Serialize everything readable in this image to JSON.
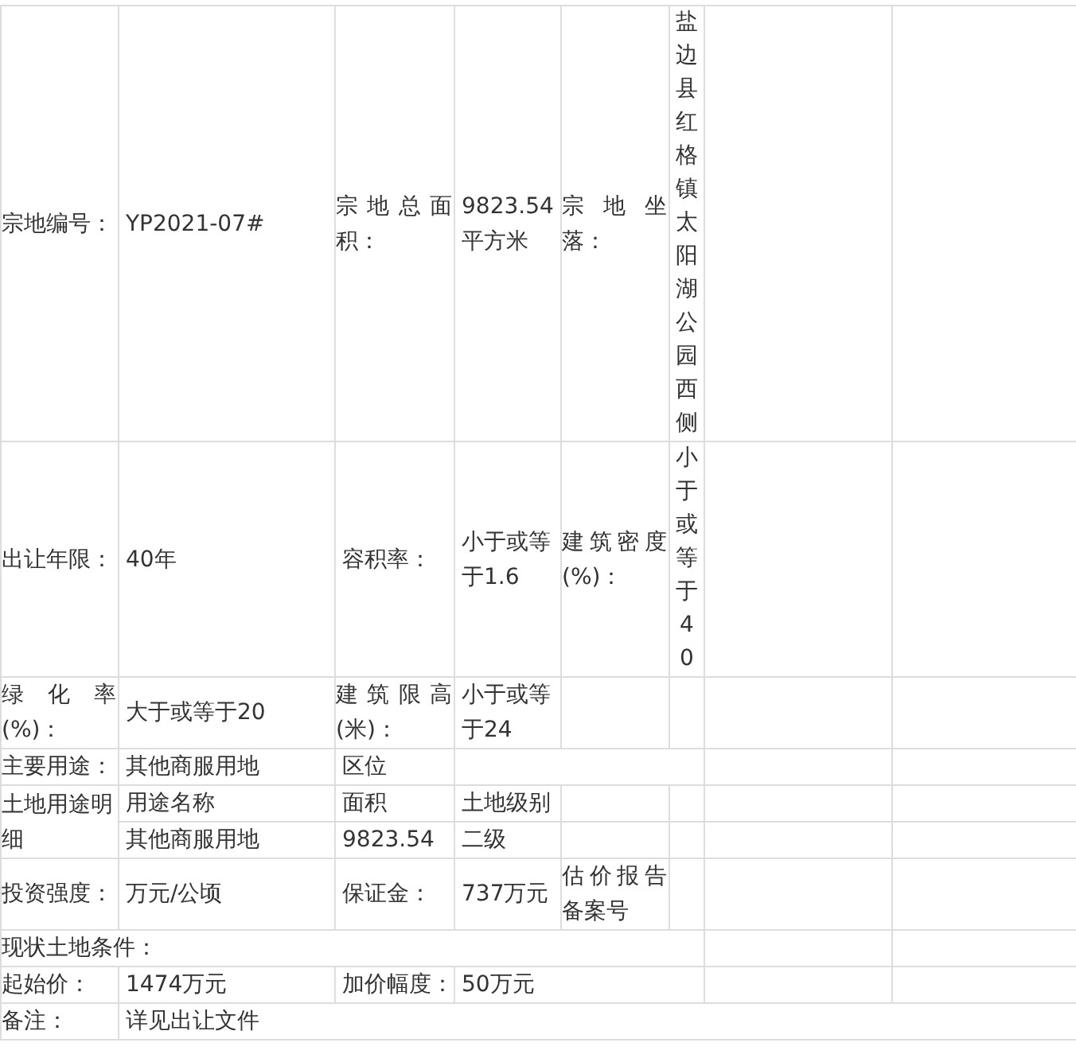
{
  "table": {
    "rows": [
      {
        "cells": [
          {
            "kind": "plain",
            "text": "宗地编号："
          },
          {
            "kind": "plain",
            "text": "YP2021-07#"
          },
          {
            "kind": "justify",
            "text": "宗地总面积："
          },
          {
            "kind": "plain",
            "text": "9823.54平方米"
          },
          {
            "kind": "justify",
            "text": "宗地坐落："
          },
          {
            "kind": "vertical",
            "text": "盐边县红格镇太阳湖公园西侧"
          },
          {
            "kind": "empty"
          },
          {
            "kind": "empty"
          }
        ]
      },
      {
        "cells": [
          {
            "kind": "plain",
            "text": "出让年限："
          },
          {
            "kind": "plain",
            "text": "40年"
          },
          {
            "kind": "plain",
            "text": "容积率："
          },
          {
            "kind": "plain",
            "text": "小于或等于1.6"
          },
          {
            "kind": "justify",
            "text": "建筑密度(%)："
          },
          {
            "kind": "vertical",
            "text": "小于或等于40"
          },
          {
            "kind": "empty"
          },
          {
            "kind": "empty"
          }
        ]
      },
      {
        "cells": [
          {
            "kind": "justify",
            "text": "绿化率(%)："
          },
          {
            "kind": "plain",
            "text": "大于或等于20"
          },
          {
            "kind": "justify",
            "text": "建筑限高(米)："
          },
          {
            "kind": "plain",
            "text": "小于或等于24"
          },
          {
            "kind": "empty"
          },
          {
            "kind": "empty"
          },
          {
            "kind": "empty"
          },
          {
            "kind": "empty"
          }
        ]
      },
      {
        "cells": [
          {
            "kind": "plain",
            "text": "主要用途："
          },
          {
            "kind": "plain",
            "text": "其他商服用地"
          },
          {
            "kind": "plain",
            "text": "区位"
          },
          {
            "kind": "empty",
            "colspan": 3
          },
          {
            "kind": "empty"
          },
          {
            "kind": "empty"
          }
        ]
      },
      {
        "cells": [
          {
            "kind": "plain",
            "text": "土地用途明细",
            "rowspan": 2
          },
          {
            "kind": "plain",
            "text": "用途名称"
          },
          {
            "kind": "plain",
            "text": "面积"
          },
          {
            "kind": "plain",
            "text": "土地级别"
          },
          {
            "kind": "empty"
          },
          {
            "kind": "empty"
          },
          {
            "kind": "empty"
          },
          {
            "kind": "empty"
          }
        ]
      },
      {
        "cells": [
          {
            "kind": "plain",
            "text": "其他商服用地"
          },
          {
            "kind": "plain",
            "text": "9823.54"
          },
          {
            "kind": "plain",
            "text": "二级"
          },
          {
            "kind": "empty"
          },
          {
            "kind": "empty"
          },
          {
            "kind": "empty"
          },
          {
            "kind": "empty"
          }
        ]
      },
      {
        "cells": [
          {
            "kind": "plain",
            "text": "投资强度："
          },
          {
            "kind": "plain",
            "text": "万元/公顷"
          },
          {
            "kind": "plain",
            "text": "保证金："
          },
          {
            "kind": "plain",
            "text": "737万元"
          },
          {
            "kind": "justify",
            "text": "估价报告备案号"
          },
          {
            "kind": "empty"
          },
          {
            "kind": "empty"
          },
          {
            "kind": "empty"
          }
        ]
      },
      {
        "cells": [
          {
            "kind": "plain",
            "text": "现状土地条件：",
            "colspan": 6
          },
          {
            "kind": "empty"
          },
          {
            "kind": "empty"
          }
        ]
      },
      {
        "cells": [
          {
            "kind": "plain",
            "text": "起始价："
          },
          {
            "kind": "plain",
            "text": "1474万元"
          },
          {
            "kind": "plain",
            "text": "加价幅度："
          },
          {
            "kind": "plain",
            "text": "50万元",
            "colspan": 3
          },
          {
            "kind": "empty"
          },
          {
            "kind": "empty"
          }
        ]
      },
      {
        "cells": [
          {
            "kind": "plain",
            "text": "备注："
          },
          {
            "kind": "plain",
            "text": "详见出让文件",
            "colspan": 7
          }
        ]
      }
    ]
  }
}
